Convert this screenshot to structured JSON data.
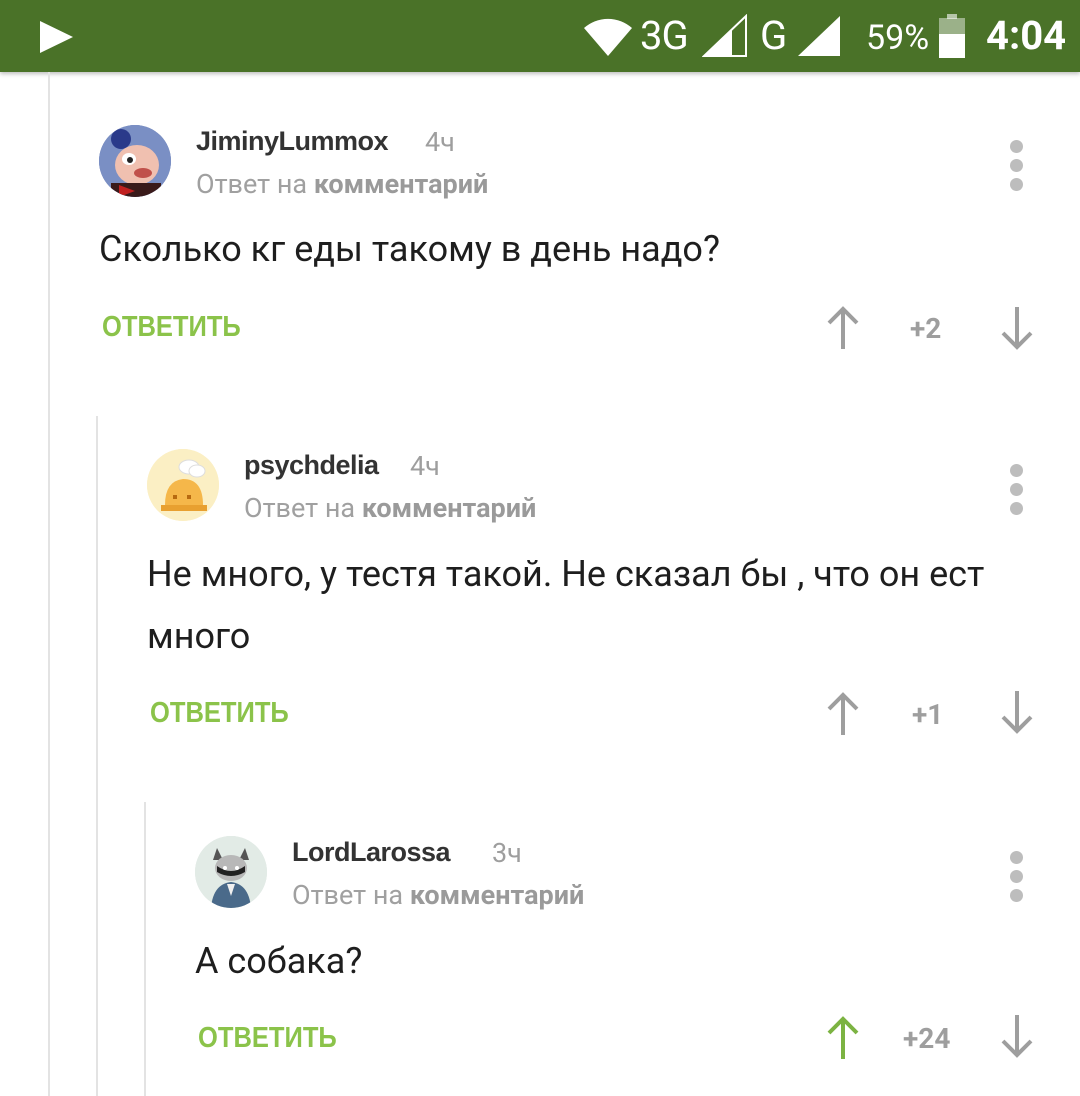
{
  "status_bar": {
    "network_3g": "3G",
    "network_g": "G",
    "battery": "59%",
    "time": "4:04"
  },
  "comments": [
    {
      "author": "JiminyLummox",
      "time": "4ч",
      "reply_prefix": "Ответ на",
      "reply_target": "комментарий",
      "text": "Сколько кг еды такому в день надо?",
      "reply_label": "ОТВЕТИТЬ",
      "score": "+2",
      "upvoted": false
    },
    {
      "author": "psychdelia",
      "time": "4ч",
      "reply_prefix": "Ответ на",
      "reply_target": "комментарий",
      "text": "Не много, у тестя такой. Не сказал бы , что он ест много",
      "reply_label": "ОТВЕТИТЬ",
      "score": "+1",
      "upvoted": false
    },
    {
      "author": "LordLarossa",
      "time": "3ч",
      "reply_prefix": "Ответ на",
      "reply_target": "комментарий",
      "text": "А собака?",
      "reply_label": "ОТВЕТИТЬ",
      "score": "+24",
      "upvoted": true
    }
  ],
  "colors": {
    "status_bar": "#4a7228",
    "accent_green": "#8bc34a",
    "upvote_active": "#7cb342",
    "arrow_gray": "#9e9e9e"
  }
}
